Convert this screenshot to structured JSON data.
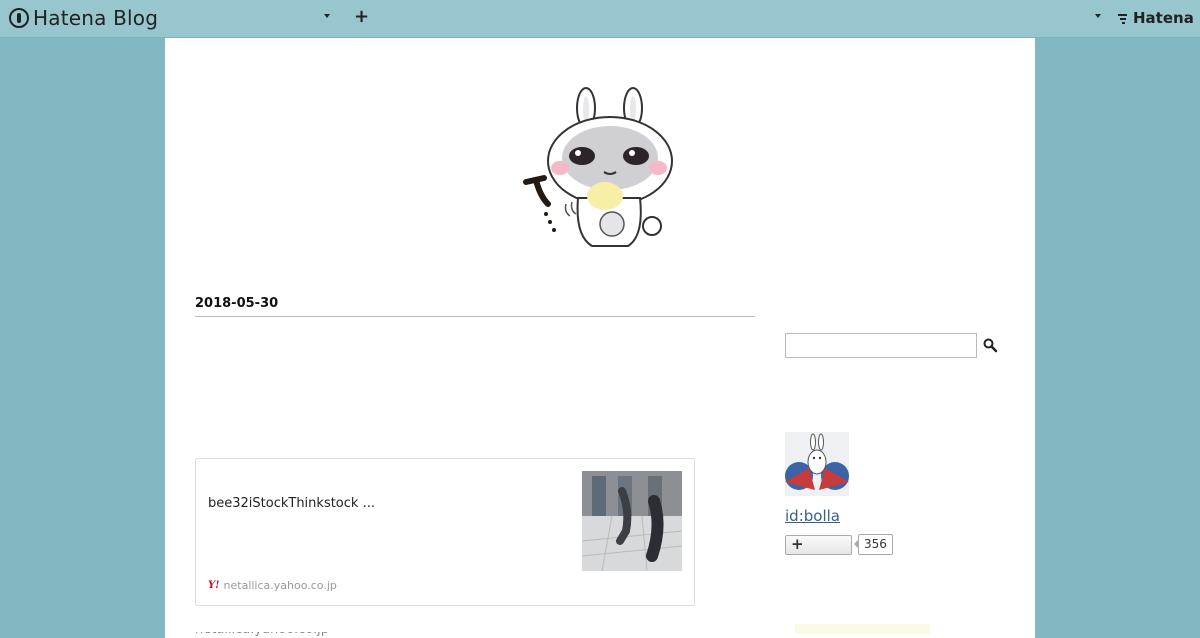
{
  "topbar": {
    "brand_text": "Hatena Blog",
    "hatena_text": "Hatena",
    "icons": [
      "hatena-blog-logo-icon",
      "chevron-down-icon",
      "plus-icon",
      "hatena-logo-icon"
    ]
  },
  "post": {
    "date": "2018-05-30",
    "card": {
      "text": "bee32iStockThinkstock ...",
      "source_host": "netallica.yahoo.co.jp",
      "source_logo": "Y!"
    },
    "clipped_text": "netallica.yahoo.co.jp"
  },
  "sidebar": {
    "search": {
      "value": "",
      "placeholder": ""
    },
    "profile": {
      "id_link": "id:bolla",
      "follow_count": "356"
    }
  },
  "colors": {
    "background": "#82b8c2",
    "topbar": "#98c6cf",
    "link": "#3a5f87"
  }
}
